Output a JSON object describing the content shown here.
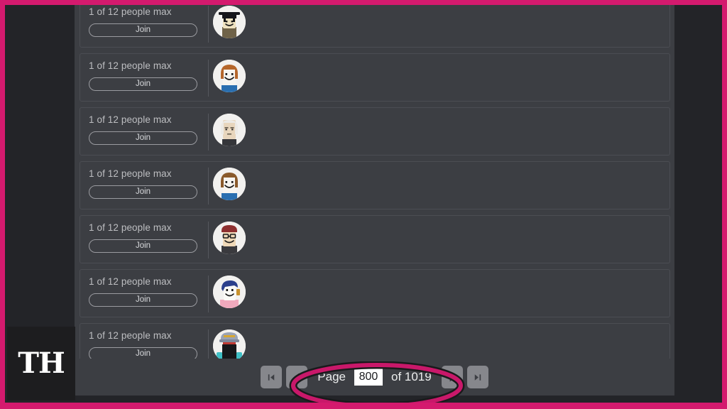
{
  "annotation": {
    "frame_color": "#d41a6e",
    "ellipse_color": "#c9186a",
    "ellipse_shadow_color": "#1a1a1c"
  },
  "watermark": {
    "text": "TH"
  },
  "servers": [
    {
      "players": "1 of 12 people max",
      "join_label": "Join",
      "avatar": "avatar-black-hat"
    },
    {
      "players": "1 of 12 people max",
      "join_label": "Join",
      "avatar": "avatar-orange-hair"
    },
    {
      "players": "1 of 12 people max",
      "join_label": "Join",
      "avatar": "avatar-white-hair"
    },
    {
      "players": "1 of 12 people max",
      "join_label": "Join",
      "avatar": "avatar-brown-hair"
    },
    {
      "players": "1 of 12 people max",
      "join_label": "Join",
      "avatar": "avatar-red-cap-glasses"
    },
    {
      "players": "1 of 12 people max",
      "join_label": "Join",
      "avatar": "avatar-blue-hair-pink-shirt"
    },
    {
      "players": "1 of 12 people max",
      "join_label": "Join",
      "avatar": "avatar-helmet-mask"
    }
  ],
  "pagination": {
    "first_label": "|<",
    "prev_label": "<",
    "page_label": "Page",
    "current_page": "800",
    "total_label": "of 1019",
    "next_label": ">",
    "last_label": ">|"
  }
}
